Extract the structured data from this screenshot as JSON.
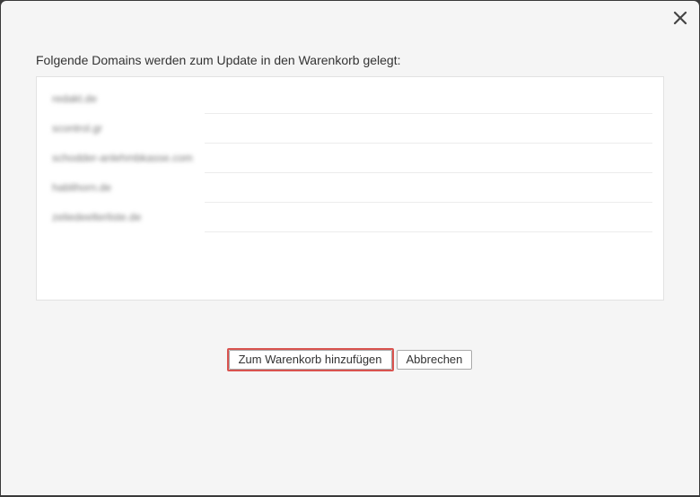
{
  "dialog": {
    "close_glyph": "✕",
    "intro_text": "Folgende Domains werden zum Update in den Warenkorb gelegt:",
    "domains": [
      "redakt.de",
      "scontrol.gr",
      "schodder-anlehmbkasse.com",
      "hablihorn.de",
      "zeliedeelterliste.de"
    ],
    "buttons": {
      "add_to_cart": "Zum Warenkorb hinzufügen",
      "cancel": "Abbrechen"
    }
  },
  "colors": {
    "dialog_bg": "#f5f5f5",
    "focus_border": "#d9534f",
    "text": "#333333"
  }
}
